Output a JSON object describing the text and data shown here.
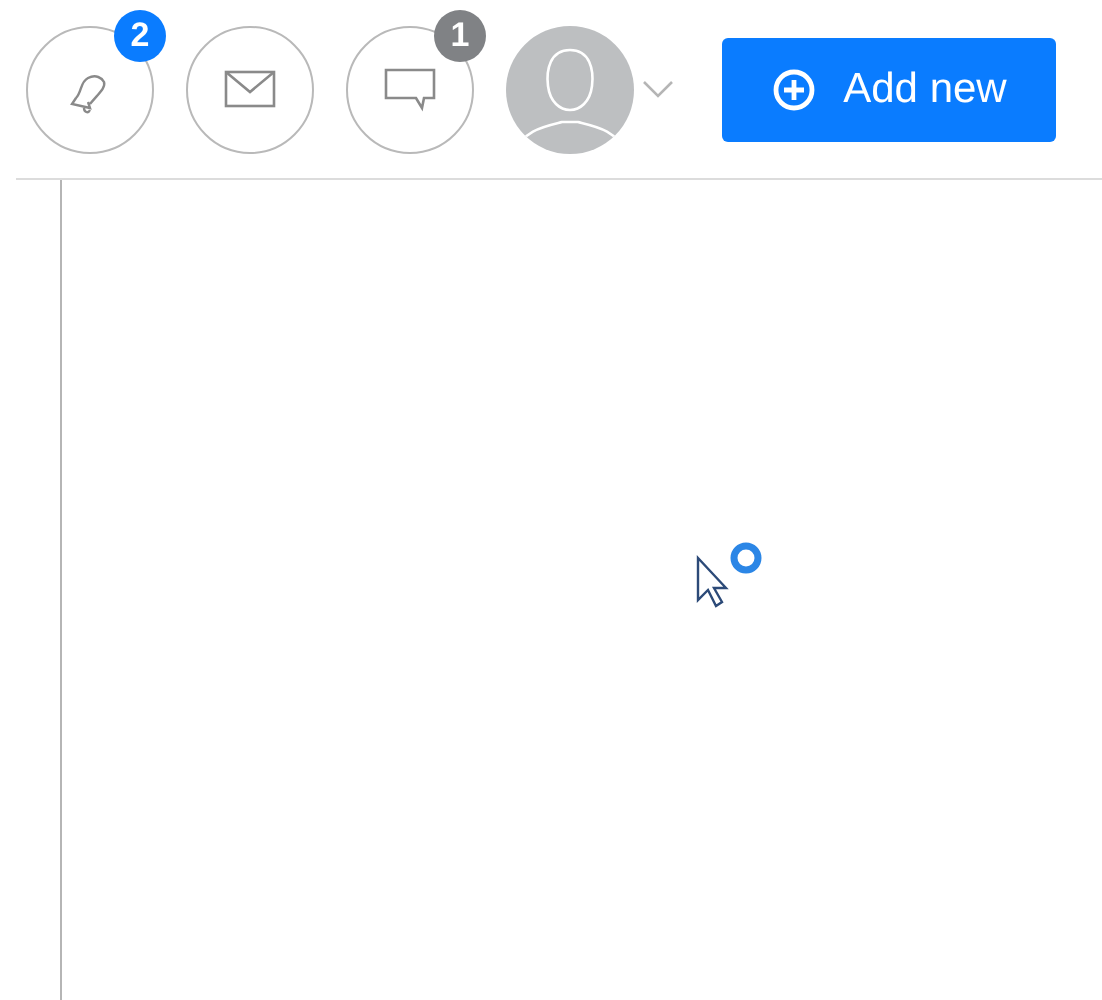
{
  "header": {
    "icon_buttons": [
      {
        "kind": "bell",
        "badge": "2",
        "color": "#0a7cff"
      },
      {
        "kind": "mail"
      },
      {
        "kind": "chat",
        "badge": "1",
        "color": "#808285"
      }
    ],
    "avatar": {
      "menu": true
    },
    "add_button": {
      "label": "Add new"
    }
  }
}
